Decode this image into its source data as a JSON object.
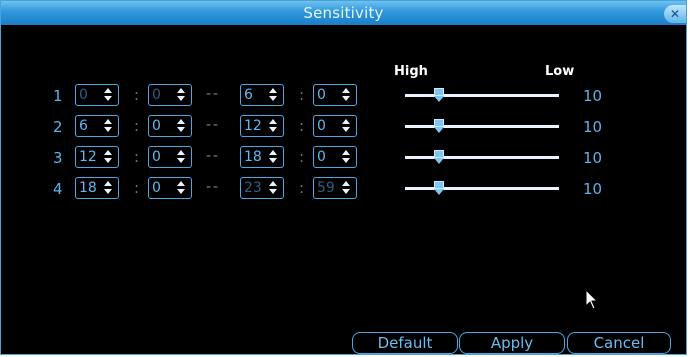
{
  "window": {
    "title": "Sensitivity",
    "close_icon": "close-icon"
  },
  "columns": {
    "high_label": "High",
    "low_label": "Low"
  },
  "separators": {
    "colon": ":",
    "dash": "--"
  },
  "rows": [
    {
      "num": "1",
      "start_hour": "0",
      "start_min": "0",
      "end_hour": "6",
      "end_min": "0",
      "sensitivity": 3,
      "level": "10"
    },
    {
      "num": "2",
      "start_hour": "6",
      "start_min": "0",
      "end_hour": "12",
      "end_min": "0",
      "sensitivity": 3,
      "level": "10"
    },
    {
      "num": "3",
      "start_hour": "12",
      "start_min": "0",
      "end_hour": "18",
      "end_min": "0",
      "sensitivity": 3,
      "level": "10"
    },
    {
      "num": "4",
      "start_hour": "18",
      "start_min": "0",
      "end_hour": "23",
      "end_min": "59",
      "sensitivity": 3,
      "level": "10"
    }
  ],
  "buttons": {
    "default_label": "Default",
    "apply_label": "Apply",
    "cancel_label": "Cancel"
  },
  "colors": {
    "accent": "#4aa9e4",
    "text": "#62b8ee",
    "titlebar": "#2f97dc",
    "background": "#000000"
  }
}
